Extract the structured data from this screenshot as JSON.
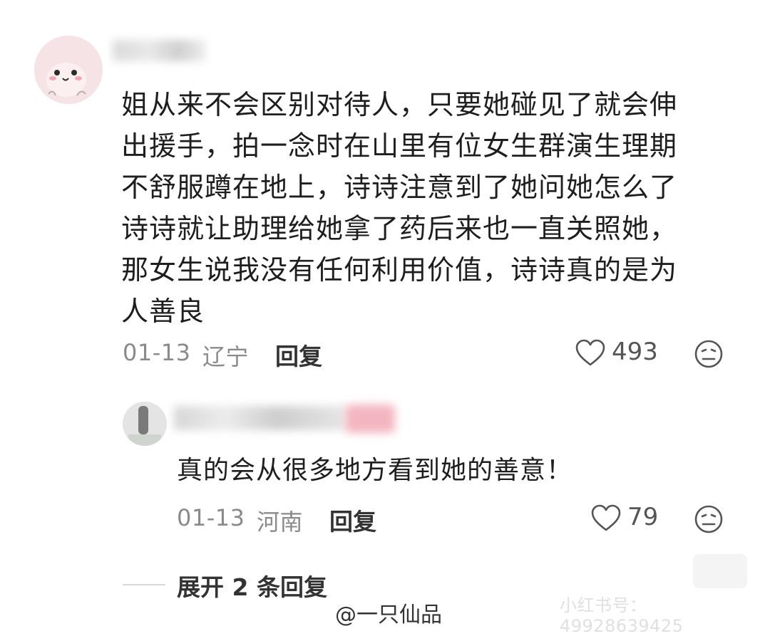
{
  "main_comment": {
    "lines": [
      "姐从来不会区别对待人，只要她碰见了就会伸",
      "出援手，拍一念时在山里有位女生群演生理期",
      "不舒服蹲在地上，诗诗注意到了她问她怎么了",
      "诗诗就让助理给她拿了药后来也一直关照她，",
      "那女生说我没有任何利用价值，诗诗真的是为",
      "人善良"
    ],
    "date": "01-13",
    "location": "辽宁",
    "reply_label": "回复",
    "like_count": "493",
    "icons": {
      "like": "heart-icon",
      "reaction": "meh-face-icon"
    }
  },
  "reply_comment": {
    "text": "真的会从很多地方看到她的善意！",
    "date": "01-13",
    "location": "河南",
    "reply_label": "回复",
    "like_count": "79",
    "icons": {
      "like": "heart-icon",
      "reaction": "meh-face-icon"
    }
  },
  "expand": {
    "label": "展开 2 条回复"
  },
  "watermarks": {
    "weibo": "@一只仙品",
    "xiaohongshu": "小红书号：49928639425"
  },
  "colors": {
    "text": "#1e1e1e",
    "meta": "#8a8a8a",
    "avatar_bg": "#f5e1e3"
  }
}
